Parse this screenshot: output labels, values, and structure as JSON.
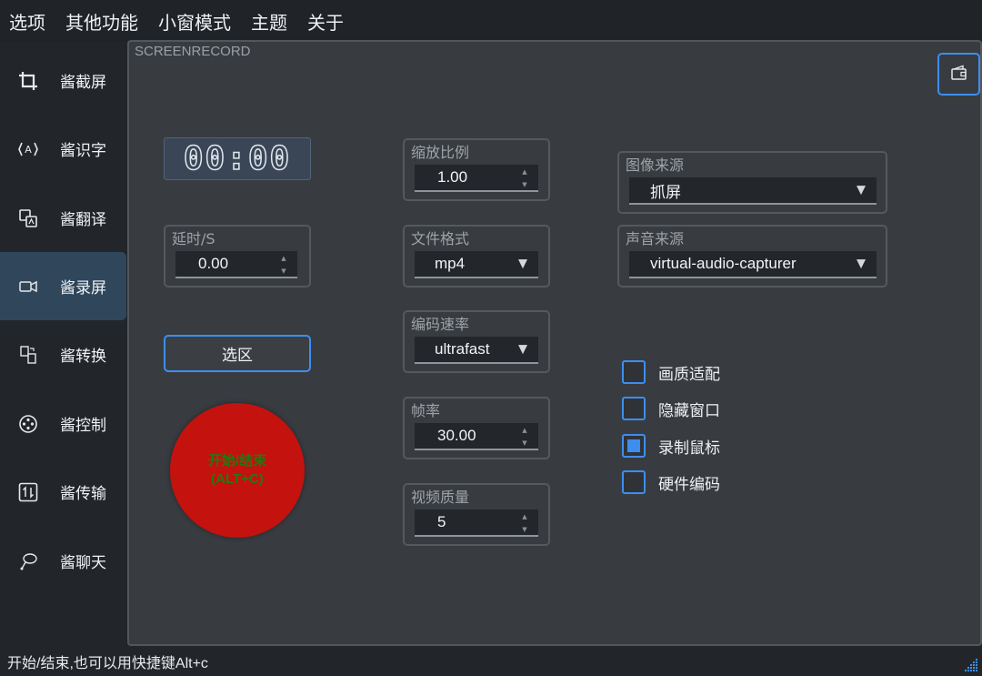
{
  "menu": [
    "选项",
    "其他功能",
    "小窗模式",
    "主题",
    "关于"
  ],
  "sidebar": {
    "items": [
      {
        "label": "酱截屏",
        "icon": "crop-icon"
      },
      {
        "label": "酱识字",
        "icon": "ocr-icon"
      },
      {
        "label": "酱翻译",
        "icon": "translate-icon"
      },
      {
        "label": "酱录屏",
        "icon": "video-camera-icon",
        "active": true
      },
      {
        "label": "酱转换",
        "icon": "convert-icon"
      },
      {
        "label": "酱控制",
        "icon": "control-icon"
      },
      {
        "label": "酱传输",
        "icon": "transfer-icon"
      },
      {
        "label": "酱聊天",
        "icon": "chat-icon"
      }
    ]
  },
  "panel": {
    "title": "SCREENRECORD",
    "timer": "00:00",
    "delay": {
      "label": "延时/S",
      "value": "0.00"
    },
    "select_label": "选区",
    "record_label_line1": "开始/结束",
    "record_label_line2": "(ALT+C)",
    "scale": {
      "label": "缩放比例",
      "value": "1.00"
    },
    "format": {
      "label": "文件格式",
      "value": "mp4"
    },
    "encode_speed": {
      "label": "编码速率",
      "value": "ultrafast"
    },
    "fps": {
      "label": "帧率",
      "value": "30.00"
    },
    "quality": {
      "label": "视频质量",
      "value": "5"
    },
    "image_source": {
      "label": "图像来源",
      "value": "抓屏"
    },
    "audio_source": {
      "label": "声音来源",
      "value": "virtual-audio-capturer"
    },
    "checkboxes": [
      {
        "label": "画质适配",
        "checked": false
      },
      {
        "label": "隐藏窗口",
        "checked": false
      },
      {
        "label": "录制鼠标",
        "checked": true
      },
      {
        "label": "硬件编码",
        "checked": false
      }
    ]
  },
  "status": "开始/结束,也可以用快捷键Alt+c",
  "colors": {
    "accent": "#3d8ef0",
    "record": "#c4120e",
    "record_text": "#1f7a10",
    "active_item": "#30465a"
  }
}
